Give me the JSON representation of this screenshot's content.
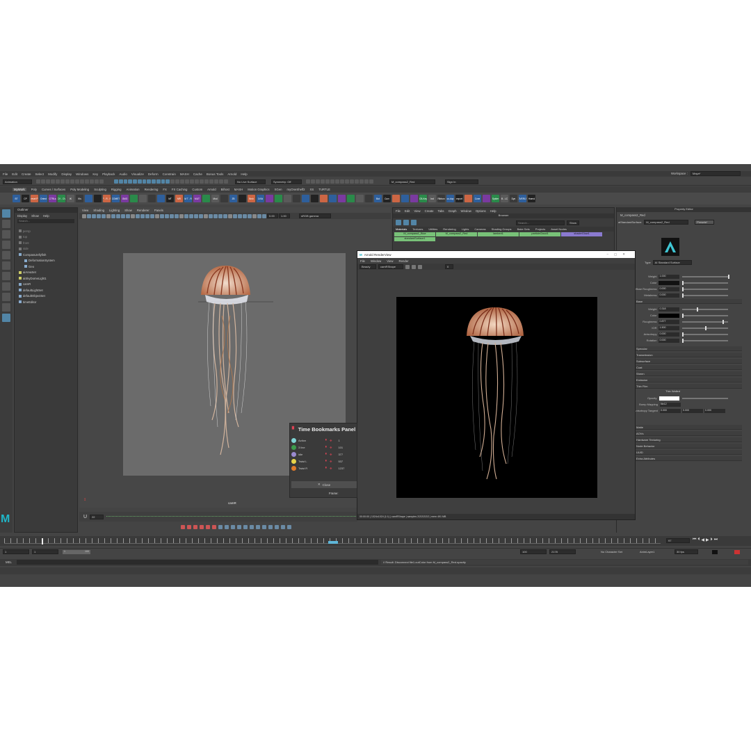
{
  "menu": [
    "File",
    "Edit",
    "Create",
    "Select",
    "Modify",
    "Display",
    "Windows",
    "Key",
    "Playback",
    "Audio",
    "Visualize",
    "Deform",
    "Constrain",
    "MASH",
    "Cache",
    "Bonus Tools",
    "Arnold",
    "Help"
  ],
  "workspace_label": "Workspace :",
  "workspace_value": "Maya*",
  "status": {
    "mode": "Animation",
    "live": "No Live Surface",
    "symmetry": "Symmetry: Off",
    "object_field": "M_compass2_Red",
    "signin": "Sign In"
  },
  "shelf_tabs": [
    "MyWork",
    "Poly",
    "Curves / Surfaces",
    "Poly Modeling",
    "Sculpting",
    "Rigging",
    "Animation",
    "Rendering",
    "FX",
    "FX Caching",
    "Custom",
    "Arnold",
    "Bifrost",
    "MASH",
    "Motion Graphics",
    "XGen",
    "myOneShelf2",
    "XS",
    "TURTLE"
  ],
  "shelf_icons": [
    "BT",
    "CP",
    "reset P",
    "Orient",
    "CTRLs",
    "CV - CV",
    "IK",
    "IKs",
    "",
    "",
    "P - R - S",
    "COMET",
    "GMG",
    "",
    "",
    "",
    "",
    "MT",
    "MR",
    "M T - R",
    "MUT",
    "",
    "Mod",
    "",
    "ZB",
    "",
    "Brsh",
    "CrSd",
    "",
    "",
    "",
    "",
    "",
    "",
    "",
    "",
    "",
    "",
    "",
    "",
    "Bot",
    "Curv",
    "",
    "",
    "",
    "CB-Key",
    "Ind",
    "Ribbon",
    "co-dup",
    "export",
    "",
    "Cone",
    "",
    "Spider",
    "B - LC",
    "Dyn",
    "OVERLS",
    "Hwrnd"
  ],
  "outliner": {
    "title": "Outliner",
    "menus": [
      "Display",
      "Show",
      "Help"
    ],
    "search": "Search...",
    "items": [
      "persp",
      "top",
      "front",
      "side",
      "CompassJellyfish",
      "DeformationSystem",
      "Geo",
      "aiAreaSet",
      "aiSkyDomeLight1",
      "camR",
      "defaultLightSet",
      "defaultObjectSet",
      "timeEditor"
    ]
  },
  "viewport": {
    "menus": [
      "View",
      "Shading",
      "Lighting",
      "Show",
      "Renderer",
      "Panels"
    ],
    "fields": [
      "0.00",
      "1.00"
    ],
    "colorspace": "sRGB gamma",
    "camera_label": "camR",
    "frame_value": "22"
  },
  "hypershade": {
    "menus": [
      "File",
      "Edit",
      "View",
      "Create",
      "Tabs",
      "Graph",
      "Window",
      "Options",
      "Help"
    ],
    "title": "Browser",
    "search": "Search...",
    "show": "Show",
    "tabs": [
      "Materials",
      "Textures",
      "Utilities",
      "Rendering",
      "Lights",
      "Cameras",
      "Shading Groups",
      "Bake Sets",
      "Projects",
      "Asset Nodes"
    ],
    "materials": [
      {
        "name": "M_compass1_Blue",
        "color": "#78c178"
      },
      {
        "name": "M_compass2_Red",
        "color": "#78c178"
      },
      {
        "name": "lambert1",
        "color": "#78c178"
      },
      {
        "name": "particleCloud1",
        "color": "#78c178"
      },
      {
        "name": "shaderGlow1",
        "color": "#8a7ad0"
      },
      {
        "name": "standardSurface1",
        "color": "#78c178"
      }
    ]
  },
  "render_view": {
    "title": "Arnold RenderView",
    "menus": [
      "File",
      "Window",
      "View",
      "Render"
    ],
    "mode": "Beauty",
    "camera": "camRShape",
    "exposure": "0",
    "status": "00:00:00 | 1024x1024 (1:1) | camRShape | samples 2/2/2/2/2/2 | mem 491 MB"
  },
  "attr_editor": {
    "title": "Property Editor",
    "node": "M_compass2_Red",
    "type_label": "aiStandardSurface:",
    "node_field": "M_compass2_Red",
    "presets": "Presets*",
    "shader_type_label": "Type",
    "shader_type": "AI Standard Surface",
    "rows": [
      {
        "label": "Weight",
        "value": "1.000",
        "pct": 1.0
      },
      {
        "label": "Color",
        "value": "",
        "pct": 0
      },
      {
        "label": "Diffuse Roughness",
        "value": "0.000",
        "pct": 0.0
      },
      {
        "label": "Metalness",
        "value": "0.000",
        "pct": 0.0
      },
      {
        "label": "Weight",
        "value": "0.318",
        "pct": 0.318
      },
      {
        "label": "Color",
        "value": "",
        "pct": 0
      },
      {
        "label": "Roughness",
        "value": "0.877",
        "pct": 0.877
      },
      {
        "label": "IOR",
        "value": "1.500",
        "pct": 0.5
      },
      {
        "label": "Anisotropy",
        "value": "0.000",
        "pct": 0.0
      },
      {
        "label": "Rotation",
        "value": "0.000",
        "pct": 0.0
      }
    ],
    "sections": [
      "Base",
      "Specular",
      "Transmission",
      "Subsurface",
      "Coat",
      "Sheen",
      "Emission",
      "Thin Film",
      "Geometry",
      "Matte",
      "AOVs",
      "Hardware Texturing",
      "Node Behavior",
      "UUID",
      "Extra Attributes"
    ],
    "thin_walled": "Thin Walled",
    "opacity_label": "Opacity",
    "bump_label": "Bump Mapping",
    "bump_value": "file12",
    "aniso_label": "Anisotropy Tangent",
    "aniso_values": [
      "0.000",
      "0.000",
      "0.000"
    ]
  },
  "bookmarks": {
    "title": "Time Bookmarks Panel",
    "items": [
      {
        "name": "Action",
        "frame": "1",
        "color": "#7fd4d4"
      },
      {
        "name": "3 line",
        "frame": "101",
        "color": "#3c9c4c"
      },
      {
        "name": "idle",
        "frame": "377",
        "color": "#9a8ad0"
      },
      {
        "name": "Twist L",
        "frame": "537",
        "color": "#e8d44a"
      },
      {
        "name": "Twist R",
        "frame": "1237",
        "color": "#e07a2a"
      }
    ],
    "close": "Close",
    "frame_label": "Frame:"
  },
  "timeline": {
    "current_frame": "97",
    "start": "1",
    "end": "2178",
    "range_start": "1",
    "range_end": "100",
    "range_a": "100",
    "range_b": "2178",
    "no_char": "No Character Set",
    "anim_layer": "AnimLayer1",
    "fps": "30 fps"
  },
  "cmd": {
    "lang": "MEL",
    "result": "// Result: Disconnect file1.outColor from M_compass2_Red.opacity"
  }
}
